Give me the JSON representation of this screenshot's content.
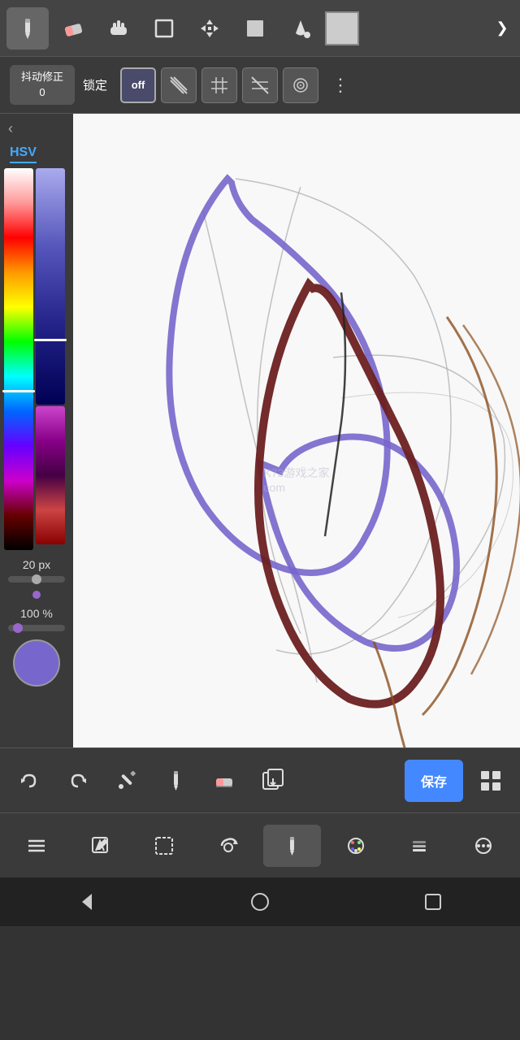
{
  "topToolbar": {
    "tools": [
      {
        "name": "pencil",
        "icon": "✏️",
        "active": true
      },
      {
        "name": "eraser",
        "icon": "⬜",
        "active": false
      },
      {
        "name": "hand",
        "icon": "✋",
        "active": false
      },
      {
        "name": "rectangle",
        "icon": "⬜",
        "active": false
      },
      {
        "name": "move",
        "icon": "✥",
        "active": false
      },
      {
        "name": "square-fill",
        "icon": "■",
        "active": false
      },
      {
        "name": "fill",
        "icon": "◈",
        "active": false
      }
    ],
    "colorPreview": "#cccccc",
    "expandLabel": "❯"
  },
  "stabilizerBar": {
    "stabLabel": "抖动修正\n0",
    "lockLabel": "锁定",
    "offLabel": "off",
    "moreIcon": "⋮"
  },
  "leftPanel": {
    "hsvLabel": "HSV",
    "brushSizeLabel": "20 px",
    "opacityLabel": "100 %"
  },
  "bottomToolbar1": {
    "undo": "↩",
    "redo": "↪",
    "pipette": "💉",
    "pencil2": "✏",
    "eraser2": "◻",
    "export": "⧉",
    "save": "保存",
    "grid": "⊞"
  },
  "bottomToolbar2": {
    "menu": "≡",
    "edit": "✎",
    "select": "⬚",
    "rotate": "↺",
    "brush": "✏",
    "palette": "🎨",
    "layers": "⧉",
    "dots": "⊕"
  },
  "navBar": {
    "back": "◁",
    "home": "○",
    "recent": "□"
  },
  "watermark": "K73游戏之家\ncom"
}
